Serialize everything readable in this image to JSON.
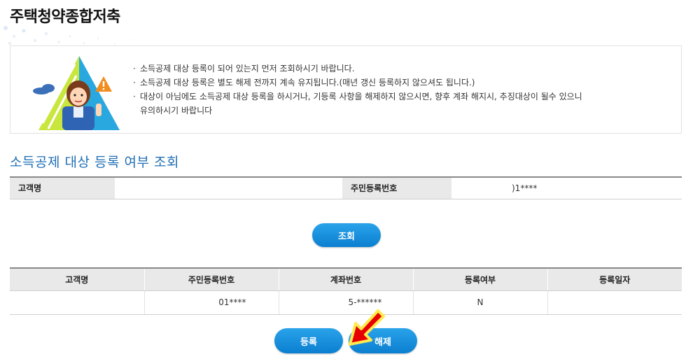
{
  "header": {
    "title": "주택청약종합저축"
  },
  "notice": {
    "items": [
      "소득공제 대상 등록이 되어 있는지 먼저 조회하시기 바랍니다.",
      "소득공제 대상 등록은 별도 해제 전까지 계속 유지됩니다.(매년 갱신 등록하지 않으셔도 됩니다.)",
      "대상이 아님에도 소득공제 대상 등록을 하시거나, 기등록 사항을 해제하지 않으시면, 향후 계좌 해지시, 추징대상이 될수 있으니"
    ],
    "continuation": "유의하시기 바랍니다"
  },
  "lookup": {
    "section_title": "소득공제 대상 등록 여부 조회",
    "name_label": "고객명",
    "name_value": "",
    "rrn_label": "주민등록번호",
    "rrn_value": ")1****",
    "search_button": "조회"
  },
  "results": {
    "headers": [
      "고객명",
      "주민등록번호",
      "계좌번호",
      "등록여부",
      "등록일자"
    ],
    "rows": [
      {
        "name": "",
        "rrn": "01****",
        "account": "5-******",
        "registered": "N",
        "date": ""
      }
    ]
  },
  "actions": {
    "register": "등록",
    "release": "해제"
  },
  "colors": {
    "accent": "#1f6fb5",
    "button": "#139be5",
    "arrow": "#e60000"
  },
  "icons": [
    "warning-icon",
    "consultant-illustration-icon",
    "pointer-arrow-icon"
  ]
}
